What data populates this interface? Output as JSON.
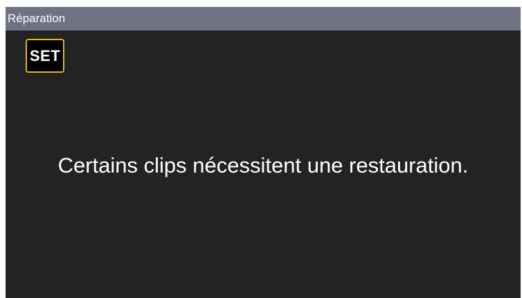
{
  "header": {
    "title": "Réparation"
  },
  "set_button": {
    "label": "SET",
    "border_color": "#e6b41e"
  },
  "message": {
    "text": "Certains clips nécessitent une restauration."
  },
  "colors": {
    "title_bar": "#6f7184",
    "screen_background": "#232323",
    "text": "#ffffff"
  }
}
